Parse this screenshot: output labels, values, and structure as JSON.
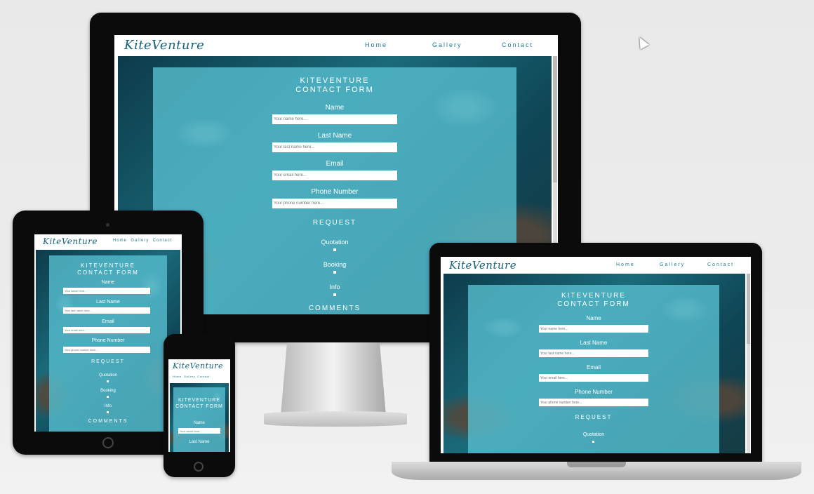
{
  "site": {
    "logo": "KiteVenture",
    "nav": [
      "Home",
      "Gallery",
      "Contact"
    ],
    "form_title_line1": "KITEVENTURE",
    "form_title_line2": "CONTACT FORM",
    "fields": [
      {
        "label": "Name",
        "placeholder": "Your name here..."
      },
      {
        "label": "Last Name",
        "placeholder": "Your last name here..."
      },
      {
        "label": "Email",
        "placeholder": "Your email here..."
      },
      {
        "label": "Phone Number",
        "placeholder": "Your phone number here..."
      }
    ],
    "request_heading": "REQUEST",
    "request_options": [
      "Quotation",
      "Booking",
      "Info"
    ],
    "comments_heading": "COMMENTS"
  },
  "tablet_nav_compact": "Home  Gallery  Contact",
  "phone_nav_compact": "Home  Gallery  Contact"
}
